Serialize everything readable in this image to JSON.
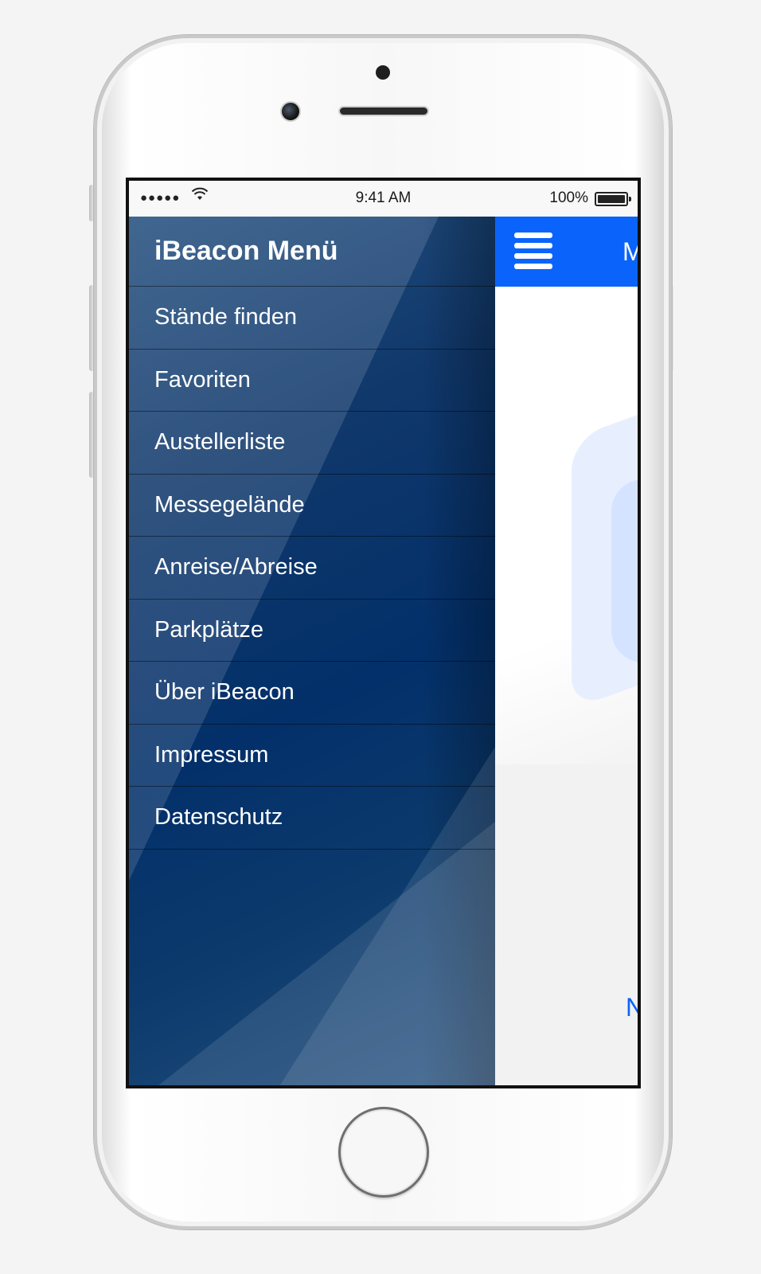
{
  "status_bar": {
    "signal": "●●●●●",
    "wifi_icon": "wifi-icon",
    "time": "9:41 AM",
    "battery_percent": "100%",
    "battery_level": 1.0
  },
  "menu": {
    "title": "iBeacon Menü",
    "items": [
      {
        "label": "Stände finden"
      },
      {
        "label": "Favoriten"
      },
      {
        "label": "Austellerliste"
      },
      {
        "label": "Messegelände"
      },
      {
        "label": "Anreise/Abreise"
      },
      {
        "label": "Parkplätze"
      },
      {
        "label": "Über iBeacon"
      },
      {
        "label": "Impressum"
      },
      {
        "label": "Datenschutz"
      }
    ]
  },
  "main": {
    "title_fragment": "M",
    "link_fragment": "N",
    "button_fragment": "",
    "menu_icon": "hamburger-menu-icon"
  },
  "colors": {
    "accent": "#0a64fb",
    "menu_background": "#03306a",
    "menu_text": "#ffffff"
  }
}
